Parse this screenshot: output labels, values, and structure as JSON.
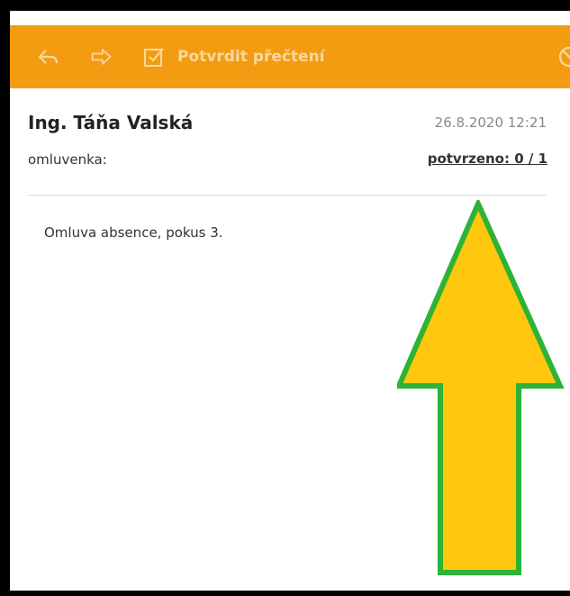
{
  "toolbar": {
    "icons": [
      "reply-icon",
      "forward-icon",
      "checkbox-icon",
      "cancel-icon"
    ],
    "confirm_label": "Potvrdit přečtení",
    "background": "#f39c12"
  },
  "message": {
    "sender": "Ing. Táňa Valská",
    "datetime": "26.8.2020 12:21",
    "subject": "omluvenka:",
    "confirmed": "potvrzeno: 0 / 1",
    "body": "Omluva absence, pokus 3."
  },
  "annotation": {
    "type": "arrow-up",
    "fill": "#ffc80f",
    "stroke": "#2db336"
  }
}
